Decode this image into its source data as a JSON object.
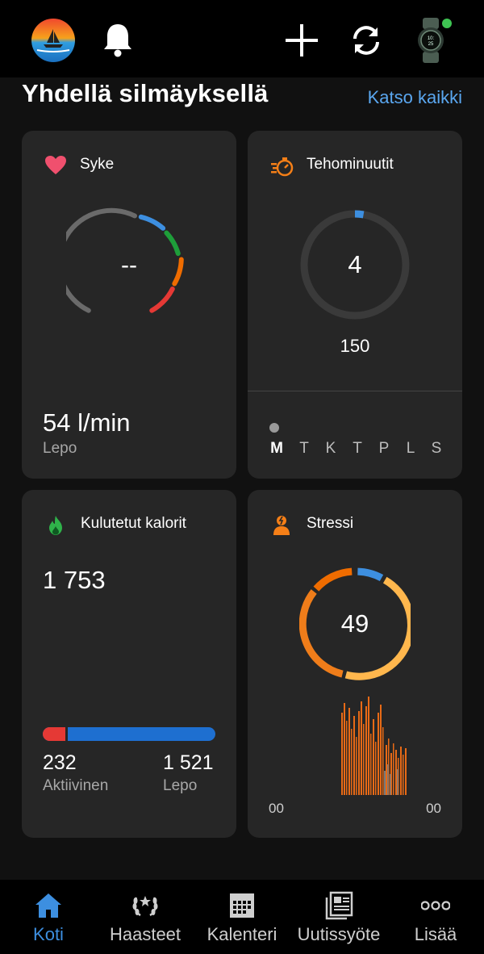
{
  "header": {
    "title": "Yhdellä silmäyksellä",
    "see_all": "Katso kaikki"
  },
  "cards": {
    "heart": {
      "title": "Syke",
      "gauge_value": "--",
      "value": "54 l/min",
      "label": "Lepo"
    },
    "intensity": {
      "title": "Tehominuutit",
      "value": "4",
      "goal": "150",
      "progress": 0.027,
      "days": [
        "M",
        "T",
        "K",
        "T",
        "P",
        "L",
        "S"
      ],
      "current_day_index": 0
    },
    "calories": {
      "title": "Kulutetut kalorit",
      "total": "1 753",
      "active_value": "232",
      "active_label": "Aktiivinen",
      "rest_value": "1 521",
      "rest_label": "Lepo",
      "active_fraction": 0.132
    },
    "stress": {
      "title": "Stressi",
      "value": "49",
      "axis_start": "00",
      "axis_end": "00"
    }
  },
  "nav": {
    "items": [
      {
        "label": "Koti",
        "active": true
      },
      {
        "label": "Haasteet",
        "active": false
      },
      {
        "label": "Kalenteri",
        "active": false
      },
      {
        "label": "Uutissyöte",
        "active": false
      },
      {
        "label": "Lisää",
        "active": false
      }
    ]
  },
  "colors": {
    "accent": "#5aa7f0",
    "nav_active": "#3d8fe0",
    "heart": "#f0506e",
    "orange": "#f57f17",
    "calorie_active": "#e53935",
    "calorie_rest": "#1e6fd0"
  }
}
